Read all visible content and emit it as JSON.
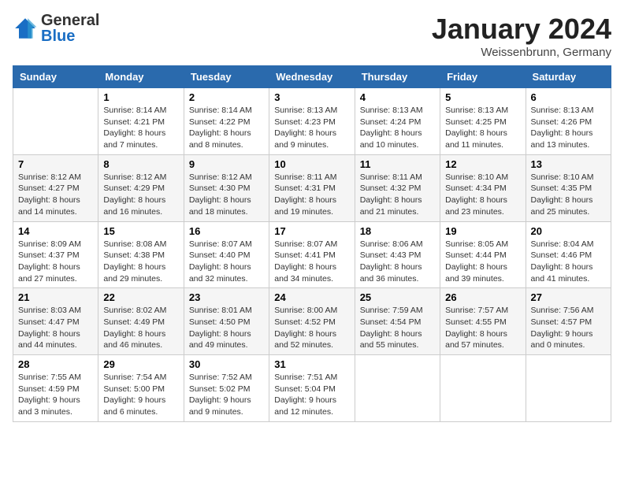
{
  "header": {
    "logo_general": "General",
    "logo_blue": "Blue",
    "month_title": "January 2024",
    "location": "Weissenbrunn, Germany"
  },
  "days_of_week": [
    "Sunday",
    "Monday",
    "Tuesday",
    "Wednesday",
    "Thursday",
    "Friday",
    "Saturday"
  ],
  "weeks": [
    [
      {
        "day": "",
        "info": ""
      },
      {
        "day": "1",
        "info": "Sunrise: 8:14 AM\nSunset: 4:21 PM\nDaylight: 8 hours\nand 7 minutes."
      },
      {
        "day": "2",
        "info": "Sunrise: 8:14 AM\nSunset: 4:22 PM\nDaylight: 8 hours\nand 8 minutes."
      },
      {
        "day": "3",
        "info": "Sunrise: 8:13 AM\nSunset: 4:23 PM\nDaylight: 8 hours\nand 9 minutes."
      },
      {
        "day": "4",
        "info": "Sunrise: 8:13 AM\nSunset: 4:24 PM\nDaylight: 8 hours\nand 10 minutes."
      },
      {
        "day": "5",
        "info": "Sunrise: 8:13 AM\nSunset: 4:25 PM\nDaylight: 8 hours\nand 11 minutes."
      },
      {
        "day": "6",
        "info": "Sunrise: 8:13 AM\nSunset: 4:26 PM\nDaylight: 8 hours\nand 13 minutes."
      }
    ],
    [
      {
        "day": "7",
        "info": "Sunrise: 8:12 AM\nSunset: 4:27 PM\nDaylight: 8 hours\nand 14 minutes."
      },
      {
        "day": "8",
        "info": "Sunrise: 8:12 AM\nSunset: 4:29 PM\nDaylight: 8 hours\nand 16 minutes."
      },
      {
        "day": "9",
        "info": "Sunrise: 8:12 AM\nSunset: 4:30 PM\nDaylight: 8 hours\nand 18 minutes."
      },
      {
        "day": "10",
        "info": "Sunrise: 8:11 AM\nSunset: 4:31 PM\nDaylight: 8 hours\nand 19 minutes."
      },
      {
        "day": "11",
        "info": "Sunrise: 8:11 AM\nSunset: 4:32 PM\nDaylight: 8 hours\nand 21 minutes."
      },
      {
        "day": "12",
        "info": "Sunrise: 8:10 AM\nSunset: 4:34 PM\nDaylight: 8 hours\nand 23 minutes."
      },
      {
        "day": "13",
        "info": "Sunrise: 8:10 AM\nSunset: 4:35 PM\nDaylight: 8 hours\nand 25 minutes."
      }
    ],
    [
      {
        "day": "14",
        "info": "Sunrise: 8:09 AM\nSunset: 4:37 PM\nDaylight: 8 hours\nand 27 minutes."
      },
      {
        "day": "15",
        "info": "Sunrise: 8:08 AM\nSunset: 4:38 PM\nDaylight: 8 hours\nand 29 minutes."
      },
      {
        "day": "16",
        "info": "Sunrise: 8:07 AM\nSunset: 4:40 PM\nDaylight: 8 hours\nand 32 minutes."
      },
      {
        "day": "17",
        "info": "Sunrise: 8:07 AM\nSunset: 4:41 PM\nDaylight: 8 hours\nand 34 minutes."
      },
      {
        "day": "18",
        "info": "Sunrise: 8:06 AM\nSunset: 4:43 PM\nDaylight: 8 hours\nand 36 minutes."
      },
      {
        "day": "19",
        "info": "Sunrise: 8:05 AM\nSunset: 4:44 PM\nDaylight: 8 hours\nand 39 minutes."
      },
      {
        "day": "20",
        "info": "Sunrise: 8:04 AM\nSunset: 4:46 PM\nDaylight: 8 hours\nand 41 minutes."
      }
    ],
    [
      {
        "day": "21",
        "info": "Sunrise: 8:03 AM\nSunset: 4:47 PM\nDaylight: 8 hours\nand 44 minutes."
      },
      {
        "day": "22",
        "info": "Sunrise: 8:02 AM\nSunset: 4:49 PM\nDaylight: 8 hours\nand 46 minutes."
      },
      {
        "day": "23",
        "info": "Sunrise: 8:01 AM\nSunset: 4:50 PM\nDaylight: 8 hours\nand 49 minutes."
      },
      {
        "day": "24",
        "info": "Sunrise: 8:00 AM\nSunset: 4:52 PM\nDaylight: 8 hours\nand 52 minutes."
      },
      {
        "day": "25",
        "info": "Sunrise: 7:59 AM\nSunset: 4:54 PM\nDaylight: 8 hours\nand 55 minutes."
      },
      {
        "day": "26",
        "info": "Sunrise: 7:57 AM\nSunset: 4:55 PM\nDaylight: 8 hours\nand 57 minutes."
      },
      {
        "day": "27",
        "info": "Sunrise: 7:56 AM\nSunset: 4:57 PM\nDaylight: 9 hours\nand 0 minutes."
      }
    ],
    [
      {
        "day": "28",
        "info": "Sunrise: 7:55 AM\nSunset: 4:59 PM\nDaylight: 9 hours\nand 3 minutes."
      },
      {
        "day": "29",
        "info": "Sunrise: 7:54 AM\nSunset: 5:00 PM\nDaylight: 9 hours\nand 6 minutes."
      },
      {
        "day": "30",
        "info": "Sunrise: 7:52 AM\nSunset: 5:02 PM\nDaylight: 9 hours\nand 9 minutes."
      },
      {
        "day": "31",
        "info": "Sunrise: 7:51 AM\nSunset: 5:04 PM\nDaylight: 9 hours\nand 12 minutes."
      },
      {
        "day": "",
        "info": ""
      },
      {
        "day": "",
        "info": ""
      },
      {
        "day": "",
        "info": ""
      }
    ]
  ]
}
